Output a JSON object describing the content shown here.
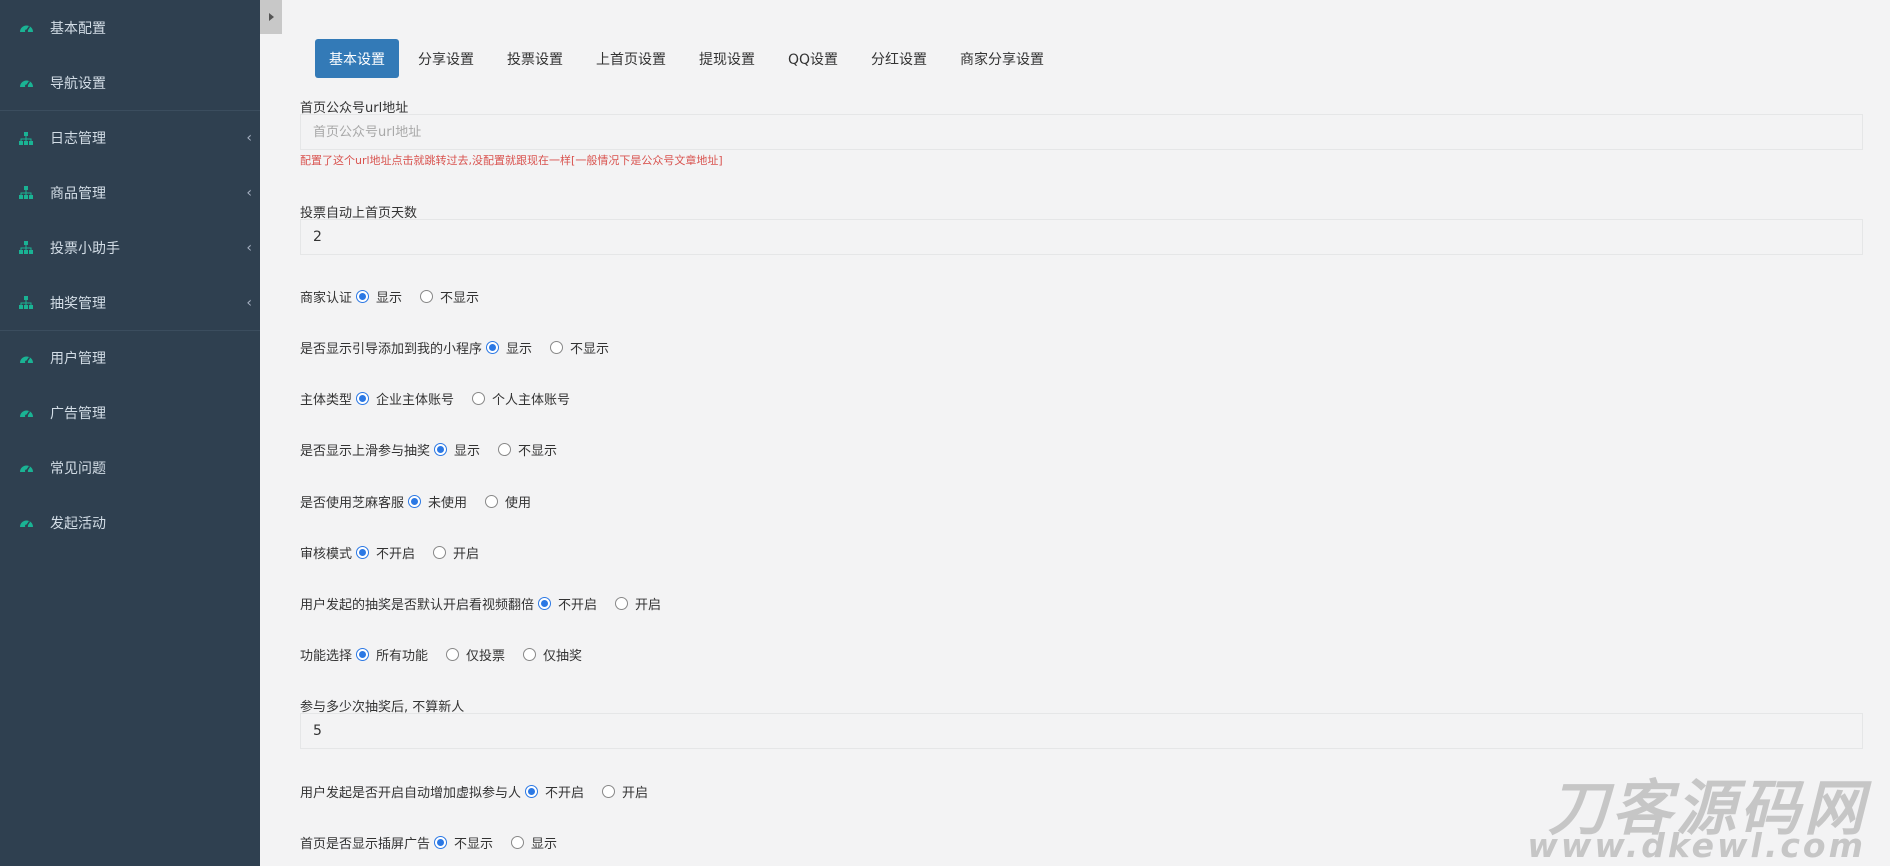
{
  "sidebar": {
    "items": [
      {
        "label": "基本配置",
        "icon": "dashboard-icon",
        "has_children": false
      },
      {
        "label": "导航设置",
        "icon": "dashboard-icon",
        "has_children": false
      },
      {
        "label": "日志管理",
        "icon": "sitemap-icon",
        "has_children": true
      },
      {
        "label": "商品管理",
        "icon": "sitemap-icon",
        "has_children": true
      },
      {
        "label": "投票小助手",
        "icon": "sitemap-icon",
        "has_children": true
      },
      {
        "label": "抽奖管理",
        "icon": "sitemap-icon",
        "has_children": true
      },
      {
        "label": "用户管理",
        "icon": "dashboard-icon",
        "has_children": false
      },
      {
        "label": "广告管理",
        "icon": "dashboard-icon",
        "has_children": false
      },
      {
        "label": "常见问题",
        "icon": "dashboard-icon",
        "has_children": false
      },
      {
        "label": "发起活动",
        "icon": "dashboard-icon",
        "has_children": false
      }
    ],
    "icon_color": "#1ab394"
  },
  "tabs": [
    "基本设置",
    "分享设置",
    "投票设置",
    "上首页设置",
    "提现设置",
    "QQ设置",
    "分红设置",
    "商家分享设置"
  ],
  "active_tab": "基本设置",
  "form": {
    "url_label": "首页公众号url地址",
    "url_placeholder": "首页公众号url地址",
    "url_hint": "配置了这个url地址点击就跳转过去,没配置就跟现在一样[一般情况下是公众号文章地址]",
    "days_label": "投票自动上首页天数",
    "days_value": "2",
    "merchant_auth": {
      "label": "商家认证",
      "options": [
        "显示",
        "不显示"
      ],
      "selected": 0
    },
    "guide_add": {
      "label": "是否显示引导添加到我的小程序",
      "options": [
        "显示",
        "不显示"
      ],
      "selected": 0
    },
    "subject_type": {
      "label": "主体类型",
      "options": [
        "企业主体账号",
        "个人主体账号"
      ],
      "selected": 0
    },
    "slide_lottery": {
      "label": "是否显示上滑参与抽奖",
      "options": [
        "显示",
        "不显示"
      ],
      "selected": 0
    },
    "sesame_service": {
      "label": "是否使用芝麻客服",
      "options": [
        "未使用",
        "使用"
      ],
      "selected": 0
    },
    "audit_mode": {
      "label": "审核模式",
      "options": [
        "不开启",
        "开启"
      ],
      "selected": 0
    },
    "video_double": {
      "label": "用户发起的抽奖是否默认开启看视频翻倍",
      "options": [
        "不开启",
        "开启"
      ],
      "selected": 0
    },
    "feature_select": {
      "label": "功能选择",
      "options": [
        "所有功能",
        "仅投票",
        "仅抽奖"
      ],
      "selected": 0
    },
    "new_user_label": "参与多少次抽奖后, 不算新人",
    "new_user_value": "5",
    "virtual_participants": {
      "label": "用户发起是否开启自动增加虚拟参与人",
      "options": [
        "不开启",
        "开启"
      ],
      "selected": 0
    },
    "popup_ad": {
      "label": "首页是否显示插屏广告",
      "options": [
        "不显示",
        "显示"
      ],
      "selected": 0
    }
  },
  "watermark": {
    "line1": "刀客源码网",
    "line2": "www.dkewl.com"
  },
  "colors": {
    "sidebar_bg": "#2f4050",
    "accent": "#337ab7",
    "radio": "#2b78e4",
    "hint": "#d9534f"
  }
}
